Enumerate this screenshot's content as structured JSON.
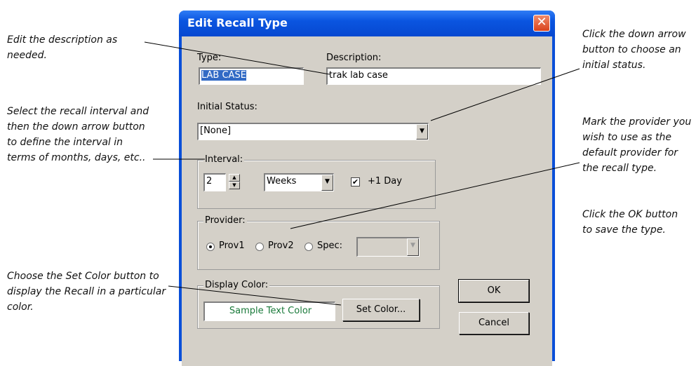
{
  "annotations": {
    "edit_description": "Edit the description as needed.",
    "select_interval": "Select the recall interval and then the down arrow button to define the interval in terms of months, days, etc..",
    "set_color": "Choose the Set Color button to display the Recall in a particular color.",
    "initial_status": "Click the down arrow button to choose an initial status.",
    "provider": "Mark the provider you wish to use as the default provider for the recall type.",
    "ok_button": "Click the OK button to save the type."
  },
  "dialog": {
    "title": "Edit Recall Type",
    "close_glyph": "✕",
    "type_label": "Type:",
    "type_value": "LAB CASE",
    "description_label": "Description:",
    "description_value": "trak lab case",
    "initial_status_label": "Initial Status:",
    "initial_status_value": "[None]",
    "interval_group": "Interval:",
    "interval_value": "2",
    "interval_unit": "Weeks",
    "plus_one_day_label": "+1 Day",
    "plus_one_day_checked": true,
    "provider_group": "Provider:",
    "provider_options": [
      "Prov1",
      "Prov2",
      "Spec:"
    ],
    "provider_selected": "Prov1",
    "spec_value": "",
    "display_color_group": "Display Color:",
    "sample_text": "Sample Text Color",
    "sample_text_color": "#1a7a3a",
    "set_color_label": "Set Color...",
    "ok_label": "OK",
    "cancel_label": "Cancel"
  },
  "icons": {
    "dropdown_arrow": "▼",
    "spin_up": "▲",
    "spin_down": "▼",
    "check": "✔"
  }
}
